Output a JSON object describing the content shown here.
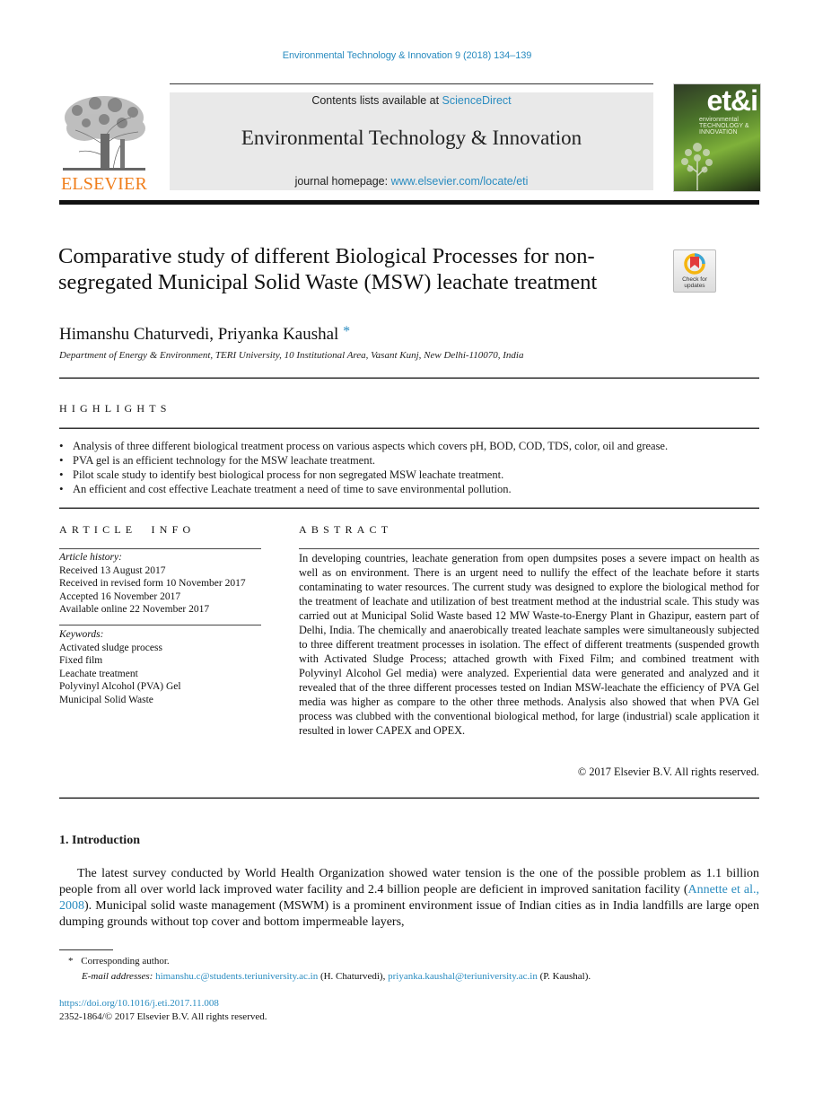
{
  "running_head": "Environmental Technology & Innovation 9 (2018) 134–139",
  "masthead": {
    "publisher": "ELSEVIER",
    "contents_prefix": "Contents lists available at ",
    "contents_link": "ScienceDirect",
    "journal_title": "Environmental Technology & Innovation",
    "homepage_prefix": "journal homepage: ",
    "homepage_link": "www.elsevier.com/locate/eti",
    "cover": {
      "logo": "et&i",
      "line1": "environmental",
      "line2": "TECHNOLOGY &",
      "line3": "INNOVATION"
    }
  },
  "check_updates": {
    "line1": "Check for",
    "line2": "updates",
    "icon": "check-updates-icon"
  },
  "article": {
    "title": "Comparative study of different Biological Processes for non-segregated Municipal Solid Waste (MSW) leachate treatment",
    "authors": "Himanshu Chaturvedi, Priyanka Kaushal",
    "corresponding_mark": "*",
    "affiliation": "Department of Energy & Environment, TERI University, 10 Institutional Area, Vasant Kunj, New Delhi-110070, India"
  },
  "highlights": {
    "heading": "HIGHLIGHTS",
    "items": [
      "Analysis of three different biological treatment process on various aspects which covers pH, BOD, COD, TDS, color, oil and grease.",
      "PVA gel is an efficient technology for the MSW leachate treatment.",
      "Pilot scale study to identify best biological process for non segregated MSW leachate treatment.",
      "An efficient and cost effective Leachate treatment a need of time to save environmental pollution."
    ]
  },
  "article_info": {
    "heading": "ARTICLE INFO",
    "history_label": "Article history:",
    "history": [
      "Received 13 August 2017",
      "Received in revised form 10 November 2017",
      "Accepted 16 November 2017",
      "Available online 22 November 2017"
    ],
    "keywords_label": "Keywords:",
    "keywords": [
      "Activated sludge process",
      "Fixed film",
      "Leachate treatment",
      "Polyvinyl Alcohol (PVA) Gel",
      "Municipal Solid Waste"
    ]
  },
  "abstract": {
    "heading": "ABSTRACT",
    "text": "In developing countries, leachate generation from open dumpsites poses a severe impact on health as well as on environment. There is an urgent need to nullify the effect of the leachate before it starts contaminating to water resources. The current study was designed to explore the biological method for the treatment of leachate and utilization of best treatment method at the industrial scale. This study was carried out at Municipal Solid Waste based 12 MW Waste-to-Energy Plant in Ghazipur, eastern part of Delhi, India. The chemically and anaerobically treated leachate samples were simultaneously subjected to three different treatment processes in isolation. The effect of different treatments (suspended growth with Activated Sludge Process; attached growth with Fixed Film; and combined treatment with Polyvinyl Alcohol Gel media) were analyzed. Experiential data were generated and analyzed and it revealed that of the three different processes tested on Indian MSW-leachate the efficiency of PVA Gel media was higher as compare to the other three methods. Analysis also showed that when PVA Gel process was clubbed with the conventional biological method, for large (industrial) scale application it resulted in lower CAPEX and OPEX.",
    "copyright": "© 2017 Elsevier B.V. All rights reserved."
  },
  "introduction": {
    "heading": "1.  Introduction",
    "text_before_cite": "The latest survey conducted by World Health Organization showed water tension is the one of the possible problem as 1.1 billion people from all over world lack improved water facility and 2.4 billion people are deficient in improved sanitation  facility (",
    "citation": "Annette et al., 2008",
    "text_after_cite": "). Municipal solid waste management (MSWM) is a prominent environment issue of Indian cities as in India landfills are large open dumping grounds without top cover and bottom impermeable layers,"
  },
  "footnotes": {
    "mark": "*",
    "corresponding": "Corresponding author.",
    "email_label": "E-mail addresses:",
    "email1": "himanshu.c@students.teriuniversity.ac.in",
    "email1_owner": " (H. Chaturvedi), ",
    "email2": "priyanka.kaushal@teriuniversity.ac.in",
    "email2_owner": " (P. Kaushal)."
  },
  "doi": "https://doi.org/10.1016/j.eti.2017.11.008",
  "issn_copyright": "2352-1864/© 2017 Elsevier B.V. All rights reserved.",
  "colors": {
    "link": "#2a8cc0",
    "elsevier_orange": "#f07e1b",
    "masthead_bg": "#e9e9e9",
    "text": "#1a1a1a"
  }
}
